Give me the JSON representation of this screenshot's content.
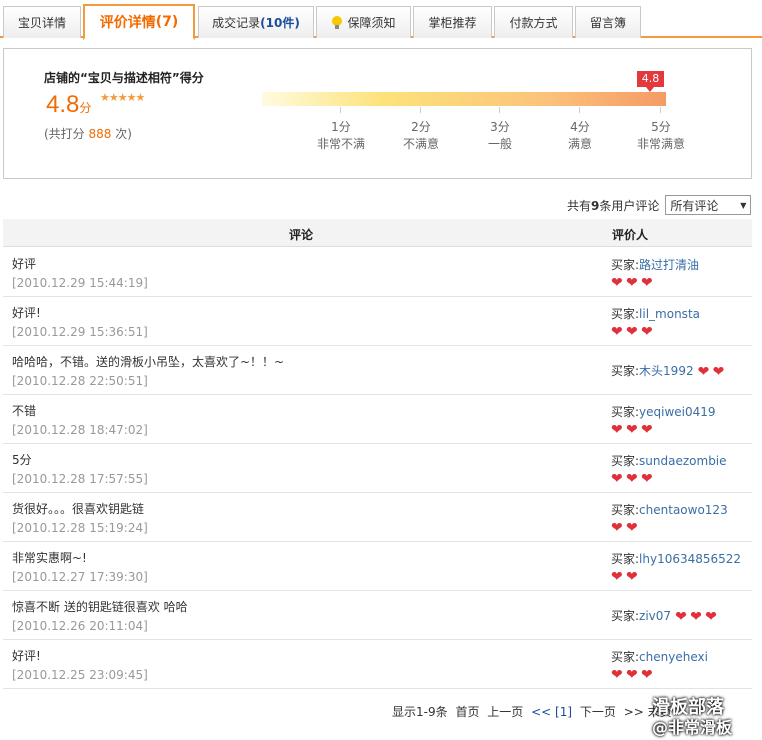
{
  "tabs": [
    {
      "label": "宝贝详情",
      "count": ""
    },
    {
      "label": "评价详情",
      "count": "(7)"
    },
    {
      "label": "成交记录",
      "count": "(10件)"
    },
    {
      "label": "保障须知",
      "count": ""
    },
    {
      "label": "掌柜推荐",
      "count": ""
    },
    {
      "label": "付款方式",
      "count": ""
    },
    {
      "label": "留言簿",
      "count": ""
    }
  ],
  "score": {
    "title": "店铺的“宝贝与描述相符”得分",
    "value": "4.8",
    "unit": "分",
    "stars": "★★★★★",
    "total_prefix": "(共打分",
    "total_count": "888",
    "total_suffix": "次)",
    "marker": "4.8",
    "levels": [
      {
        "score": "1分",
        "label": "非常不满"
      },
      {
        "score": "2分",
        "label": "不满意"
      },
      {
        "score": "3分",
        "label": "一般"
      },
      {
        "score": "4分",
        "label": "满意"
      },
      {
        "score": "5分",
        "label": "非常满意"
      }
    ]
  },
  "filter": {
    "prefix": "共有",
    "count": "9",
    "suffix": "条用户评论",
    "selected": "所有评论"
  },
  "table": {
    "col_comment": "评论",
    "col_reviewer": "评价人",
    "buyer_label": "买家:",
    "rows": [
      {
        "comment": "好评",
        "date": "[2010.12.29 15:44:19]",
        "buyer": "路过打清油",
        "hearts": 3
      },
      {
        "comment": "好评!",
        "date": "[2010.12.29 15:36:51]",
        "buyer": "lil_monsta",
        "hearts": 3
      },
      {
        "comment": "哈哈哈，不错。送的滑板小吊坠，太喜欢了~！！~",
        "date": "[2010.12.28 22:50:51]",
        "buyer": "木头1992",
        "hearts": 2
      },
      {
        "comment": "不错",
        "date": "[2010.12.28 18:47:02]",
        "buyer": "yeqiwei0419",
        "hearts": 3
      },
      {
        "comment": "5分",
        "date": "[2010.12.28 17:57:55]",
        "buyer": "sundaezombie",
        "hearts": 3
      },
      {
        "comment": "货很好。。。很喜欢钥匙链",
        "date": "[2010.12.28 15:19:24]",
        "buyer": "chentaowo123",
        "hearts": 2
      },
      {
        "comment": "非常实惠啊~!",
        "date": "[2010.12.27 17:39:30]",
        "buyer": "lhy10634856522",
        "hearts": 2
      },
      {
        "comment": "惊喜不断 送的钥匙链很喜欢 哈哈",
        "date": "[2010.12.26 20:11:04]",
        "buyer": "ziv07",
        "hearts": 3
      },
      {
        "comment": "好评!",
        "date": "[2010.12.25 23:09:45]",
        "buyer": "chenyehexi",
        "hearts": 3
      }
    ]
  },
  "pager": {
    "range": "显示1-9条",
    "first": "首页",
    "prev": "上一页",
    "current": "<< [1]",
    "next": "下一页",
    "last": ">> 末页"
  },
  "watermark": {
    "line1": "滑板部落",
    "line2": "@非常滑板"
  }
}
